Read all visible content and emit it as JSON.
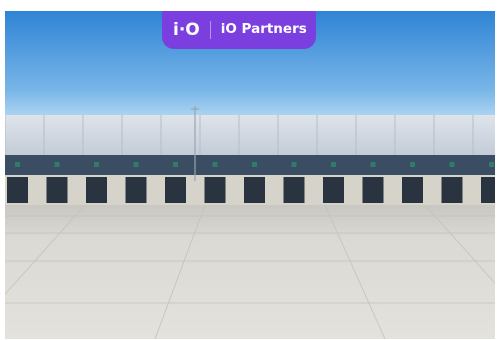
{
  "brand": {
    "mark": "i·O",
    "name": "iO Partners",
    "color": "#7b3fe0"
  },
  "scene": {
    "subject": "warehouse-loading-docks",
    "colors": {
      "sky_top": "#2f86d6",
      "sky_bottom": "#a9d3f2",
      "cladding": "#cfd6e0",
      "band": "#3a4d63",
      "dock_door": "#2a3440",
      "plinth": "#d8d6cc",
      "yard": "#d9d6cf",
      "accent_signs": "#2e7d6a"
    }
  }
}
